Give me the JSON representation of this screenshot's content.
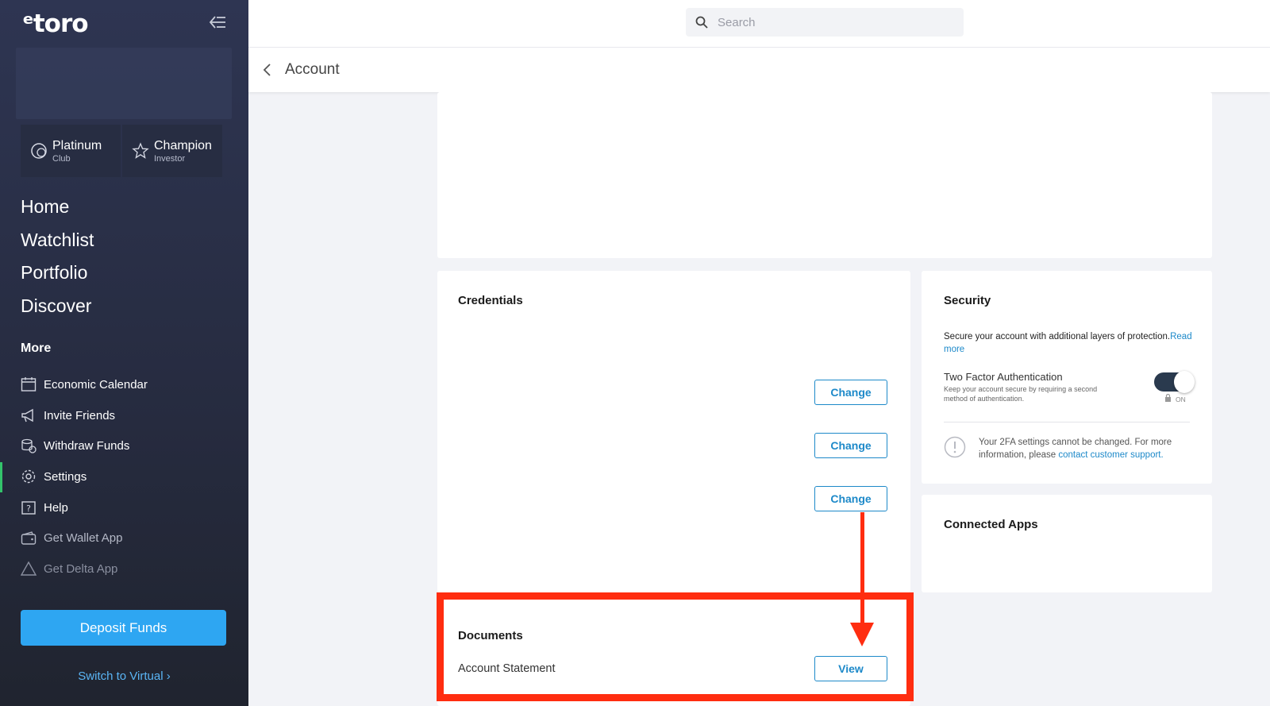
{
  "brand": {
    "logo_text": "ᵉtoro"
  },
  "badges": [
    {
      "title": "Platinum",
      "subtitle": "Club"
    },
    {
      "title": "Champion",
      "subtitle": "Investor"
    }
  ],
  "main_nav": [
    "Home",
    "Watchlist",
    "Portfolio",
    "Discover"
  ],
  "more_label": "More",
  "sub_nav": [
    {
      "label": "Economic Calendar",
      "icon": "calendar-icon"
    },
    {
      "label": "Invite Friends",
      "icon": "megaphone-icon"
    },
    {
      "label": "Withdraw Funds",
      "icon": "coins-icon"
    },
    {
      "label": "Settings",
      "icon": "gear-icon"
    },
    {
      "label": "Help",
      "icon": "help-icon"
    },
    {
      "label": "Get Wallet App",
      "icon": "wallet-icon"
    },
    {
      "label": "Get Delta App",
      "icon": "delta-icon"
    }
  ],
  "deposit_label": "Deposit Funds",
  "switch_label": "Switch to Virtual ›",
  "search": {
    "placeholder": "Search"
  },
  "page": {
    "title": "Account"
  },
  "credentials": {
    "title": "Credentials",
    "change_label": "Change"
  },
  "security": {
    "title": "Security",
    "desc": "Secure your account with additional layers of protection.",
    "read_more": "Read more",
    "tfa_title": "Two Factor Authentication",
    "tfa_desc": "Keep your account secure by requiring a second method of authentication.",
    "toggle_state": "ON",
    "notice_text": "Your 2FA settings cannot be changed. For more information, please ",
    "notice_link": "contact customer support."
  },
  "connected_apps": {
    "title": "Connected Apps"
  },
  "documents": {
    "title": "Documents",
    "row_label": "Account Statement",
    "view_label": "View"
  },
  "colors": {
    "accent": "#1d89c9",
    "deposit": "#2ea6f2",
    "highlight": "#ff2d10",
    "active": "#33c36b"
  }
}
